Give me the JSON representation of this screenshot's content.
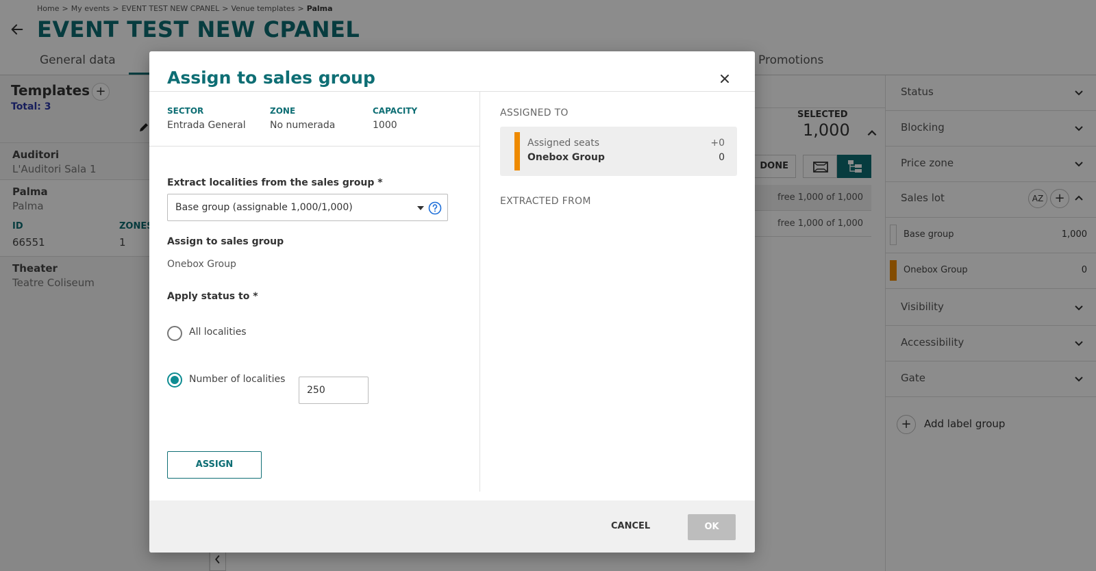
{
  "breadcrumb": [
    "Home",
    "My events",
    "EVENT TEST NEW CPANEL",
    "Venue templates",
    "Palma"
  ],
  "page": {
    "title": "EVENT TEST NEW CPANEL",
    "tabs": {
      "general": "General data",
      "promotions": "Promotions"
    }
  },
  "templates": {
    "title": "Templates",
    "add": "+",
    "total": "Total: 3",
    "items": [
      {
        "name": "Auditori",
        "sub": "L'Auditori Sala 1"
      },
      {
        "name": "Palma",
        "sub": "Palma",
        "id_label": "ID",
        "id_value": "66551",
        "zones_label": "ZONES",
        "zones_value": "1"
      },
      {
        "name": "Theater",
        "sub": "Teatre Coliseum"
      }
    ]
  },
  "mid": {
    "selected_label": "SELECTED",
    "selected_value": "1,000",
    "done_label": "DONE",
    "free_rows": [
      "free 1,000 of 1,000",
      "free 1,000 of 1,000"
    ]
  },
  "right_panel": {
    "status": "Status",
    "blocking": "Blocking",
    "price_zone": "Price zone",
    "sales_lot": "Sales lot",
    "sort_label": "AZ",
    "add": "+",
    "lots": [
      {
        "name": "Base group",
        "value": "1,000",
        "color": "#ffffff"
      },
      {
        "name": "Onebox Group",
        "value": "0",
        "color": "#ee8a00"
      }
    ],
    "visibility": "Visibility",
    "accessibility": "Accessibility",
    "gate": "Gate",
    "add_label_group": "Add label group"
  },
  "modal": {
    "title": "Assign to sales group",
    "info": {
      "sector_label": "SECTOR",
      "sector_value": "Entrada General",
      "zone_label": "ZONE",
      "zone_value": "No numerada",
      "capacity_label": "CAPACITY",
      "capacity_value": "1000"
    },
    "extract_label": "Extract localities from the sales group *",
    "extract_value": "Base group (assignable 1,000/1,000)",
    "assign_to_label": "Assign to sales group",
    "assign_to_value": "Onebox Group",
    "apply_status_label": "Apply status to *",
    "radio_all": "All localities",
    "radio_number": "Number of localities",
    "number_value": "250",
    "assign_button": "ASSIGN",
    "assigned_to_title": "ASSIGNED TO",
    "assigned_card": {
      "label": "Assigned seats",
      "group": "Onebox Group",
      "delta": "+0",
      "count": "0",
      "color": "#ee8a00"
    },
    "extracted_from_title": "EXTRACTED FROM",
    "cancel": "CANCEL",
    "ok": "OK"
  }
}
